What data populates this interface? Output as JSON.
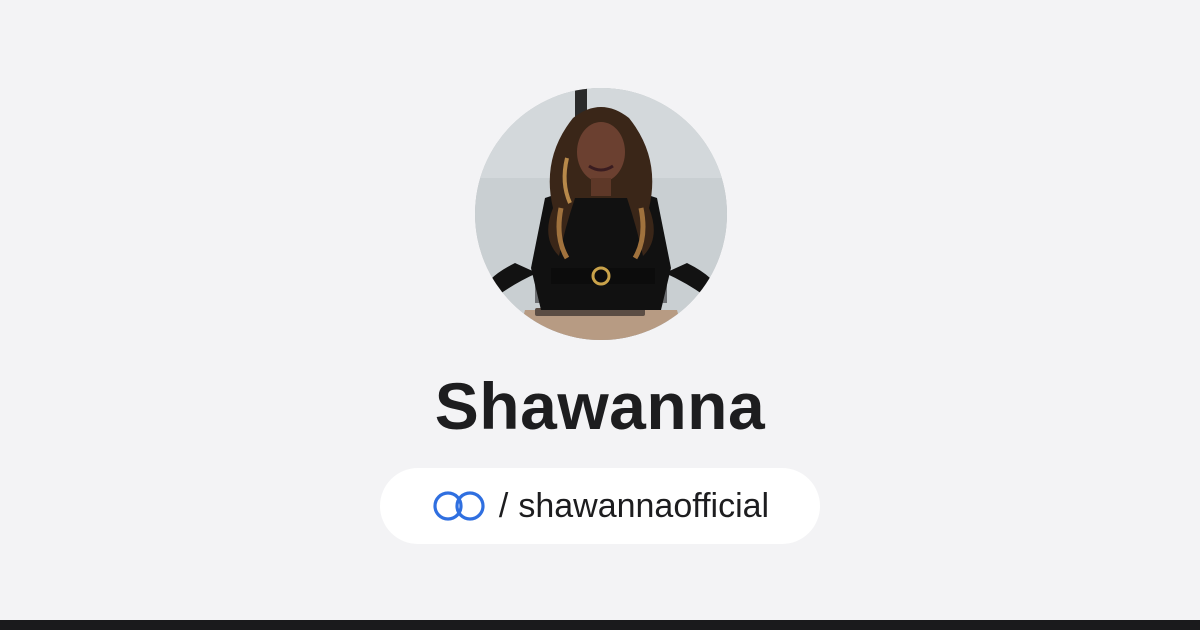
{
  "profile": {
    "name": "Shawanna",
    "handle_separator": "/",
    "handle": "shawannaofficial",
    "logo_icon": "linked-rings-logo-icon",
    "avatar_icon": "profile-photo"
  },
  "colors": {
    "background": "#f3f3f5",
    "name_text": "#1d1d1f",
    "pill_background": "#ffffff",
    "logo_blue": "#2f6fe0",
    "bottom_bar": "#1a1a1c"
  }
}
